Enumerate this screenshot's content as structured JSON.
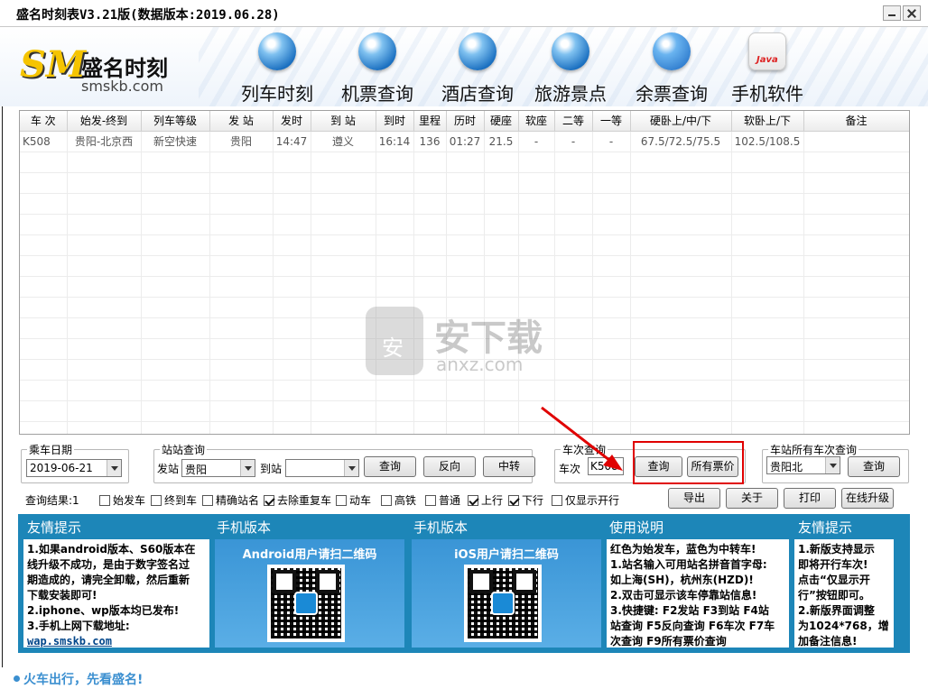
{
  "window": {
    "title": "盛名时刻表V3.21版(数据版本:2019.06.28)"
  },
  "logo": {
    "mark": "SM",
    "name": "盛名时刻",
    "url": "smskb.com"
  },
  "nav": [
    {
      "label": "列车时刻",
      "icon": "train-icon"
    },
    {
      "label": "机票查询",
      "icon": "airplane-icon"
    },
    {
      "label": "酒店查询",
      "icon": "hotel-icon"
    },
    {
      "label": "旅游景点",
      "icon": "globe-icon"
    },
    {
      "label": "余票查询",
      "icon": "windows-icon"
    },
    {
      "label": "手机软件",
      "icon": "java-icon"
    }
  ],
  "table": {
    "headers": [
      "车 次",
      "始发-终到",
      "列车等级",
      "发 站",
      "发时",
      "到 站",
      "到时",
      "里程",
      "历时",
      "硬座",
      "软座",
      "二等",
      "一等",
      "硬卧上/中/下",
      "软卧上/下",
      "备注"
    ],
    "rows": [
      [
        "K508",
        "贵阳-北京西",
        "新空快速",
        "贵阳",
        "14:47",
        "遵义",
        "16:14",
        "136",
        "01:27",
        "21.5",
        "-",
        "-",
        "-",
        "67.5/72.5/75.5",
        "102.5/108.5",
        ""
      ]
    ]
  },
  "watermark": {
    "text": "安下载",
    "url": "anxz.com"
  },
  "date_group": {
    "legend": "乘车日期",
    "value": "2019-06-21"
  },
  "station_group": {
    "legend": "站站查询",
    "from_label": "发站",
    "from_value": "贵阳",
    "to_label": "到站",
    "to_value": "",
    "query_button": "查询",
    "reverse_button": "反向",
    "transfer_button": "中转"
  },
  "train_group": {
    "legend": "车次查询",
    "label": "车次",
    "value": "K508",
    "query_button": "查询",
    "all_prices_button": "所有票价"
  },
  "station_all_group": {
    "legend": "车站所有车次查询",
    "value": "贵阳北",
    "query_button": "查询"
  },
  "options": {
    "result_label": "查询结果:1",
    "items": [
      {
        "label": "始发车",
        "checked": false
      },
      {
        "label": "终到车",
        "checked": false
      },
      {
        "label": "精确站名",
        "checked": false
      },
      {
        "label": "去除重复车",
        "checked": true
      },
      {
        "label": "动车",
        "checked": false
      },
      {
        "label": "高铁",
        "checked": false
      },
      {
        "label": "普通",
        "checked": false
      },
      {
        "label": "上行",
        "checked": true
      },
      {
        "label": "下行",
        "checked": true
      },
      {
        "label": "仅显示开行",
        "checked": false
      }
    ]
  },
  "actions": {
    "export": "导出",
    "about": "关于",
    "print": "打印",
    "upgrade": "在线升级"
  },
  "info": {
    "col1_title": "友情提示",
    "col1_lines": [
      "1.如果android版本、S60版本在",
      "线升级不成功，是由于数字签名过",
      "期造成的，请完全卸载，然后重新",
      "下载安装即可!",
      "2.iphone、wp版本均已发布!",
      "3.手机上网下载地址:"
    ],
    "col1_link": "wap.smskb.com",
    "col2_title": "手机版本",
    "col2_qr_title": "Android用户请扫二维码",
    "col3_title": "手机版本",
    "col3_qr_title": "iOS用户请扫二维码",
    "col4_title": "使用说明",
    "col4_lines": [
      "红色为始发车，蓝色为中转车!",
      "1.站名输入可用站名拼音首字母:",
      "如上海(SH)，杭州东(HZD)!",
      "2.双击可显示该车停靠站信息!",
      "3.快捷键: F2发站 F3到站 F4站",
      "站查询 F5反向查询 F6车次 F7车",
      "次查询 F9所有票价查询"
    ],
    "col5_title": "友情提示",
    "col5_lines": [
      "1.新版支持显示",
      "即将开行车次!",
      "点击“仅显示开",
      "行”按钮即可。",
      "2.新版界面调整",
      "为1024*768，增",
      "加备注信息!"
    ]
  },
  "status": {
    "text": "火车出行，先看盛名!"
  },
  "colors": {
    "panel_blue": "#1d86b8",
    "highlight_red": "#e00000",
    "status_blue": "#3b8fd0"
  }
}
